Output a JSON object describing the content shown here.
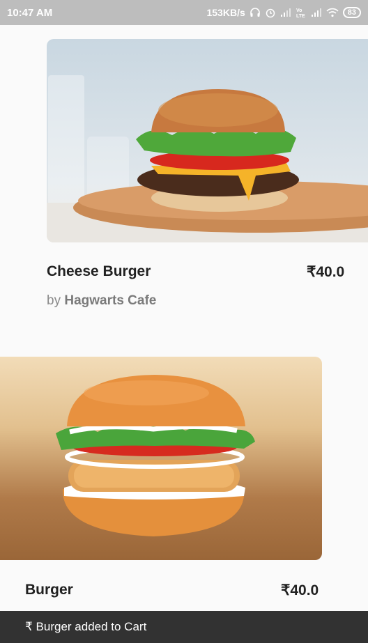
{
  "status_bar": {
    "time": "10:47 AM",
    "network_speed": "153KB/s",
    "battery": "83",
    "icons": [
      "headphones-icon",
      "alarm-icon",
      "signal-icon",
      "volte-icon",
      "signal-icon",
      "wifi-icon",
      "battery-icon"
    ]
  },
  "items": [
    {
      "name": "Cheese Burger",
      "price": "₹40.0",
      "by_prefix": "by",
      "vendor": "Hagwarts Cafe"
    },
    {
      "name": "Burger",
      "price": "₹40.0"
    }
  ],
  "snackbar": {
    "message": "₹ Burger added to Cart"
  }
}
